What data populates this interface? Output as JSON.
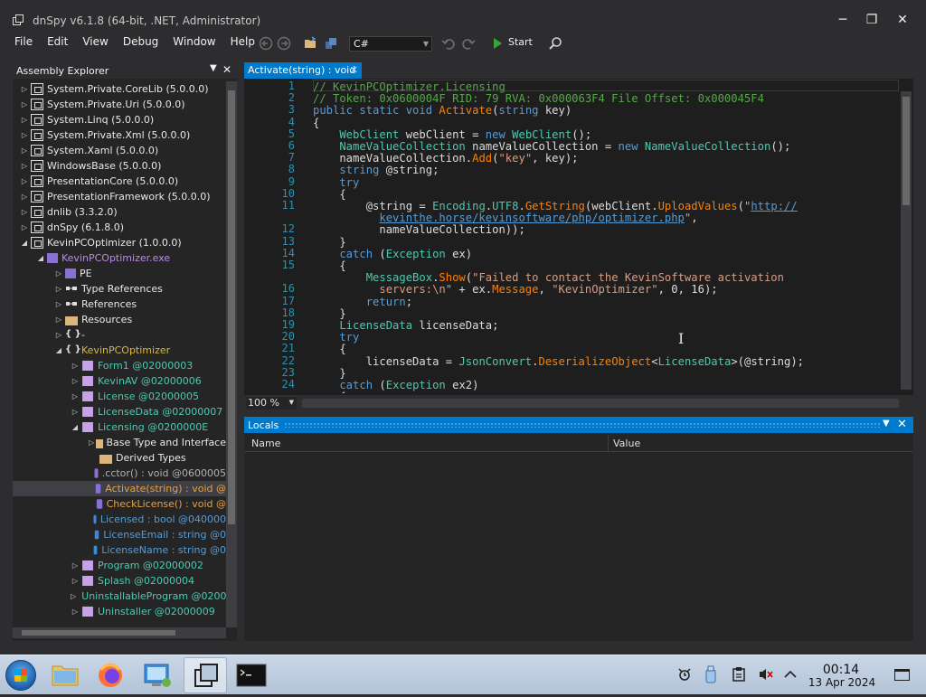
{
  "window": {
    "title": "dnSpy v6.1.8 (64-bit, .NET, Administrator)",
    "minimize_glyph": "─",
    "maximize_glyph": "❐",
    "close_glyph": "✕"
  },
  "menu": [
    "File",
    "Edit",
    "View",
    "Debug",
    "Window",
    "Help"
  ],
  "toolbar": {
    "language": "C#",
    "start_label": "Start"
  },
  "explorer": {
    "title": "Assembly Explorer",
    "pin_glyph": "▼",
    "close_glyph": "✕",
    "items": [
      {
        "label": "System.Private.CoreLib (5.0.0.0)",
        "expander": "▷",
        "icon": "assembly",
        "color": "white"
      },
      {
        "label": "System.Private.Uri (5.0.0.0)",
        "expander": "▷",
        "icon": "assembly",
        "color": "white"
      },
      {
        "label": "System.Linq (5.0.0.0)",
        "expander": "▷",
        "icon": "assembly",
        "color": "white"
      },
      {
        "label": "System.Private.Xml (5.0.0.0)",
        "expander": "▷",
        "icon": "assembly",
        "color": "white"
      },
      {
        "label": "System.Xaml (5.0.0.0)",
        "expander": "▷",
        "icon": "assembly",
        "color": "white"
      },
      {
        "label": "WindowsBase (5.0.0.0)",
        "expander": "▷",
        "icon": "assembly",
        "color": "white"
      },
      {
        "label": "PresentationCore (5.0.0.0)",
        "expander": "▷",
        "icon": "assembly",
        "color": "white"
      },
      {
        "label": "PresentationFramework (5.0.0.0)",
        "expander": "▷",
        "icon": "assembly",
        "color": "white"
      },
      {
        "label": "dnlib (3.3.2.0)",
        "expander": "▷",
        "icon": "assembly",
        "color": "white"
      },
      {
        "label": "dnSpy (6.1.8.0)",
        "expander": "▷",
        "icon": "assembly",
        "color": "white"
      },
      {
        "label": "KevinPCOptimizer (1.0.0.0)",
        "expander": "◢",
        "icon": "assembly",
        "color": "white"
      },
      {
        "label": "KevinPCOptimizer.exe",
        "expander": "◢",
        "icon": "module",
        "color": "purple"
      },
      {
        "label": "PE",
        "expander": "▷",
        "icon": "module",
        "color": "white"
      },
      {
        "label": "Type References",
        "expander": "▷",
        "icon": "refs",
        "color": "white"
      },
      {
        "label": "References",
        "expander": "▷",
        "icon": "refs",
        "color": "white"
      },
      {
        "label": "Resources",
        "expander": "▷",
        "icon": "folder",
        "color": "white"
      },
      {
        "label": "-",
        "expander": "▷",
        "icon": "namespace",
        "color": "white"
      },
      {
        "label": "KevinPCOptimizer",
        "expander": "◢",
        "icon": "namespace",
        "color": "yellow"
      },
      {
        "label": "Form1 @02000003",
        "expander": "▷",
        "icon": "class",
        "color": "teal"
      },
      {
        "label": "KevinAV @02000006",
        "expander": "▷",
        "icon": "class",
        "color": "teal"
      },
      {
        "label": "License @02000005",
        "expander": "▷",
        "icon": "class",
        "color": "teal"
      },
      {
        "label": "LicenseData @02000007",
        "expander": "▷",
        "icon": "class",
        "color": "teal"
      },
      {
        "label": "Licensing @0200000E",
        "expander": "◢",
        "icon": "class",
        "color": "teal"
      },
      {
        "label": "Base Type and Interface",
        "expander": "▷",
        "icon": "folder",
        "color": "white"
      },
      {
        "label": "Derived Types",
        "expander": "",
        "icon": "folder",
        "color": "white"
      },
      {
        "label": ".cctor() : void @0600005",
        "expander": "",
        "icon": "method",
        "color": "gray"
      },
      {
        "label": "Activate(string) : void @",
        "expander": "",
        "icon": "method",
        "color": "orange"
      },
      {
        "label": "CheckLicense() : void @",
        "expander": "",
        "icon": "method",
        "color": "orange"
      },
      {
        "label": "Licensed : bool @040000",
        "expander": "",
        "icon": "field",
        "color": "blue"
      },
      {
        "label": "LicenseEmail : string @0",
        "expander": "",
        "icon": "field",
        "color": "blue"
      },
      {
        "label": "LicenseName : string @0",
        "expander": "",
        "icon": "field",
        "color": "blue"
      },
      {
        "label": "Program @02000002",
        "expander": "▷",
        "icon": "class",
        "color": "teal"
      },
      {
        "label": "Splash @02000004",
        "expander": "▷",
        "icon": "class",
        "color": "teal"
      },
      {
        "label": "UninstallableProgram @0200",
        "expander": "▷",
        "icon": "class",
        "color": "teal"
      },
      {
        "label": "Uninstaller @02000009",
        "expander": "▷",
        "icon": "class",
        "color": "teal"
      }
    ]
  },
  "editor": {
    "tab_label": "Activate(string) : void",
    "tab_close": "✕",
    "zoom": "100 %",
    "line_numbers": [
      "1",
      "2",
      "3",
      "4",
      "5",
      "6",
      "7",
      "8",
      "9",
      "10",
      "11",
      "",
      "12",
      "13",
      "14",
      "15",
      "",
      "16",
      "17",
      "18",
      "19",
      "20",
      "21",
      "22",
      "23",
      "24"
    ],
    "lines": [
      [
        [
          "c-com",
          "// KevinPCOptimizer.Licensing"
        ]
      ],
      [
        [
          "c-com",
          "// Token: 0x0600004F RID: 79 RVA: 0x000063F4 File Offset: 0x000045F4"
        ]
      ],
      [
        [
          "c-kw",
          "public static void "
        ],
        [
          "c-me",
          "Activate"
        ],
        [
          "c-id",
          "("
        ],
        [
          "c-kw",
          "string"
        ],
        [
          "c-id",
          " key)"
        ]
      ],
      [
        [
          "c-id",
          "{"
        ]
      ],
      [
        [
          "c-ty",
          "    WebClient"
        ],
        [
          "c-id",
          " webClient = "
        ],
        [
          "c-kw",
          "new "
        ],
        [
          "c-ty",
          "WebClient"
        ],
        [
          "c-id",
          "();"
        ]
      ],
      [
        [
          "c-ty",
          "    NameValueCollection"
        ],
        [
          "c-id",
          " nameValueCollection = "
        ],
        [
          "c-kw",
          "new "
        ],
        [
          "c-ty",
          "NameValueCollection"
        ],
        [
          "c-id",
          "();"
        ]
      ],
      [
        [
          "c-id",
          "    nameValueCollection."
        ],
        [
          "c-me",
          "Add"
        ],
        [
          "c-id",
          "("
        ],
        [
          "c-str",
          "\"key\""
        ],
        [
          "c-id",
          ", key);"
        ]
      ],
      [
        [
          "c-kw",
          "    string"
        ],
        [
          "c-id",
          " @string;"
        ]
      ],
      [
        [
          "c-kw",
          "    try"
        ]
      ],
      [
        [
          "c-id",
          "    {"
        ]
      ],
      [
        [
          "c-id",
          "        @string = "
        ],
        [
          "c-ty",
          "Encoding"
        ],
        [
          "c-id",
          "."
        ],
        [
          "c-ty",
          "UTF8"
        ],
        [
          "c-id",
          "."
        ],
        [
          "c-me",
          "GetString"
        ],
        [
          "c-id",
          "(webClient."
        ],
        [
          "c-me",
          "UploadValues"
        ],
        [
          "c-id",
          "("
        ],
        [
          "c-str",
          "\""
        ],
        [
          "c-url",
          "http://"
        ]
      ],
      [
        [
          "c-id",
          "          "
        ],
        [
          "c-url",
          "kevinthe.horse/kevinsoftware/php/optimizer.php"
        ],
        [
          "c-str",
          "\""
        ],
        [
          "c-id",
          ","
        ]
      ],
      [
        [
          "c-id",
          "          nameValueCollection));"
        ]
      ],
      [
        [
          "c-id",
          "    }"
        ]
      ],
      [
        [
          "c-kw",
          "    catch"
        ],
        [
          "c-id",
          " ("
        ],
        [
          "c-ty",
          "Exception"
        ],
        [
          "c-id",
          " ex)"
        ]
      ],
      [
        [
          "c-id",
          "    {"
        ]
      ],
      [
        [
          "c-ty",
          "        MessageBox"
        ],
        [
          "c-id",
          "."
        ],
        [
          "c-me",
          "Show"
        ],
        [
          "c-id",
          "("
        ],
        [
          "c-str",
          "\"Failed to contact the KevinSoftware activation"
        ]
      ],
      [
        [
          "c-str",
          "          servers:\\n\""
        ],
        [
          "c-id",
          " + ex."
        ],
        [
          "c-me",
          "Message"
        ],
        [
          "c-id",
          ", "
        ],
        [
          "c-str",
          "\"KevinOptimizer\""
        ],
        [
          "c-id",
          ", 0, 16);"
        ]
      ],
      [
        [
          "c-kw",
          "        return"
        ],
        [
          "c-id",
          ";"
        ]
      ],
      [
        [
          "c-id",
          "    }"
        ]
      ],
      [
        [
          "c-ty",
          "    LicenseData"
        ],
        [
          "c-id",
          " licenseData;"
        ]
      ],
      [
        [
          "c-kw",
          "    try"
        ]
      ],
      [
        [
          "c-id",
          "    {"
        ]
      ],
      [
        [
          "c-id",
          "        licenseData = "
        ],
        [
          "c-ty",
          "JsonConvert"
        ],
        [
          "c-id",
          "."
        ],
        [
          "c-me",
          "DeserializeObject"
        ],
        [
          "c-id",
          "<"
        ],
        [
          "c-ty",
          "LicenseData"
        ],
        [
          "c-id",
          ">(@string);"
        ]
      ],
      [
        [
          "c-id",
          "    }"
        ]
      ],
      [
        [
          "c-kw",
          "    catch"
        ],
        [
          "c-id",
          " ("
        ],
        [
          "c-ty",
          "Exception"
        ],
        [
          "c-id",
          " ex2)"
        ]
      ],
      [
        [
          "c-id",
          "    {"
        ]
      ]
    ]
  },
  "locals": {
    "title": "Locals",
    "pin_glyph": "▼",
    "close_glyph": "✕",
    "columns": [
      "Name",
      "Value"
    ]
  },
  "taskbar": {
    "time": "00:14",
    "date": "13 Apr 2024"
  }
}
